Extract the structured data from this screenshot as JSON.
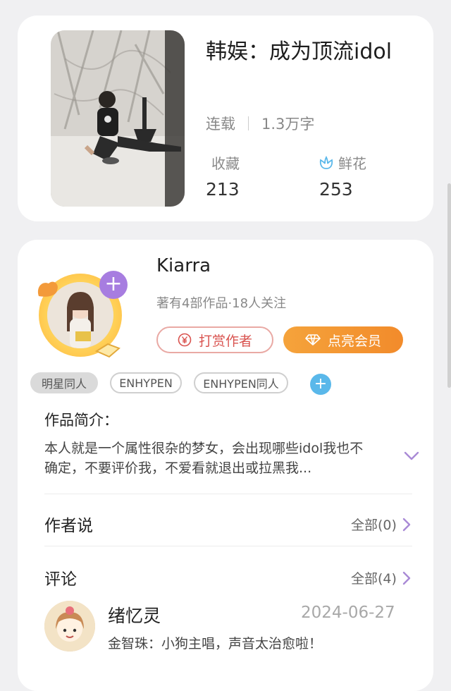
{
  "book": {
    "title": "韩娱：成为顶流idol",
    "status": "连载",
    "word_count": "1.3万字",
    "favorites_label": "收藏",
    "favorites_count": "213",
    "flowers_label": "鲜花",
    "flowers_count": "253"
  },
  "author": {
    "name": "Kiarra",
    "meta": "著有4部作品·18人关注",
    "tip_label": "打赏作者",
    "vip_label": "点亮会员"
  },
  "tags": [
    "明星同人",
    "ENHYPEN",
    "ENHYPEN同人"
  ],
  "intro": {
    "label": "作品简介：",
    "text": "本人就是一个属性很杂的梦女，会出现哪些idol我也不确定，不要评价我，不爱看就退出或拉黑我..."
  },
  "author_says": {
    "label": "作者说",
    "see_all": "全部(0)"
  },
  "comments": {
    "label": "评论",
    "see_all": "全部(4)",
    "items": [
      {
        "user": "绪忆灵",
        "date": "2024-06-27",
        "text": "金智珠：小狗主唱，声音太治愈啦！"
      }
    ]
  },
  "colors": {
    "accent_purple": "#a77de0",
    "vip_orange": "#f28b2b",
    "tip_red": "#d9534f",
    "tag_blue": "#5ab8ea"
  }
}
